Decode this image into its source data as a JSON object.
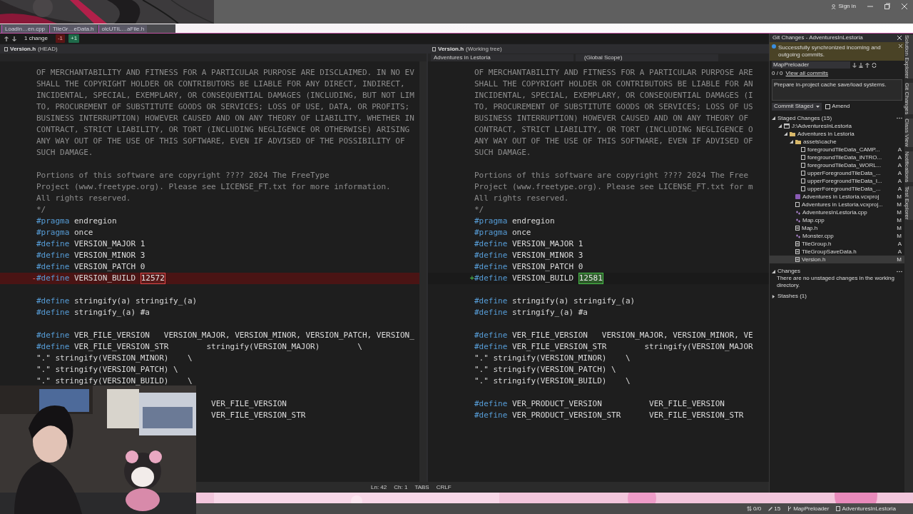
{
  "title_bar": {
    "sign_in": "Sign in"
  },
  "file_tabs": [
    "Loadin…en.cpp",
    "TileGr…eData.h",
    "olcUTIL…aFile.h"
  ],
  "diff_toolbar": {
    "change_count": "1 change",
    "removed": "-1",
    "added": "+1"
  },
  "left_pane": {
    "title": "Version.h",
    "subtitle": "(HEAD)",
    "lines": [
      {
        "kind": "comment",
        "text": "OF MERCHANTABILITY AND FITNESS FOR A PARTICULAR PURPOSE ARE DISCLAIMED. IN NO EV"
      },
      {
        "kind": "comment",
        "text": "SHALL THE COPYRIGHT HOLDER OR CONTRIBUTORS BE LIABLE FOR ANY DIRECT, INDIRECT,"
      },
      {
        "kind": "comment",
        "text": "INCIDENTAL, SPECIAL, EXEMPLARY, OR CONSEQUENTIAL DAMAGES (INCLUDING, BUT NOT LIM"
      },
      {
        "kind": "comment",
        "text": "TO, PROCUREMENT OF SUBSTITUTE GOODS OR SERVICES; LOSS OF USE, DATA, OR PROFITS;"
      },
      {
        "kind": "comment",
        "text": "BUSINESS INTERRUPTION) HOWEVER CAUSED AND ON ANY THEORY OF LIABILITY, WHETHER IN"
      },
      {
        "kind": "comment",
        "text": "CONTRACT, STRICT LIABILITY, OR TORT (INCLUDING NEGLIGENCE OR OTHERWISE) ARISING"
      },
      {
        "kind": "comment",
        "text": "ANY WAY OUT OF THE USE OF THIS SOFTWARE, EVEN IF ADVISED OF THE POSSIBILITY OF"
      },
      {
        "kind": "comment",
        "text": "SUCH DAMAGE."
      },
      {
        "kind": "blank"
      },
      {
        "kind": "comment",
        "text": "Portions of this software are copyright ???? 2024 The FreeType"
      },
      {
        "kind": "comment",
        "text": "Project (www.freetype.org). Please see LICENSE_FT.txt for more information."
      },
      {
        "kind": "comment",
        "text": "All rights reserved."
      },
      {
        "kind": "comment",
        "text": "*/"
      },
      {
        "kind": "code",
        "keyword": "#pragma",
        "text": "endregion"
      },
      {
        "kind": "code",
        "keyword": "#pragma",
        "text": "once"
      },
      {
        "kind": "code",
        "keyword": "#define",
        "text": "VERSION_MAJOR 1"
      },
      {
        "kind": "code",
        "keyword": "#define",
        "text": "VERSION_MINOR 3"
      },
      {
        "kind": "code",
        "keyword": "#define",
        "text": "VERSION_PATCH 0"
      },
      {
        "kind": "removed",
        "prefix": "-",
        "keyword": "#define",
        "text": "VERSION_BUILD",
        "changed": "12572"
      },
      {
        "kind": "blank"
      },
      {
        "kind": "code",
        "keyword": "#define",
        "text": "stringify(a) stringify_(a)"
      },
      {
        "kind": "code",
        "keyword": "#define",
        "text": "stringify_(a) #a"
      },
      {
        "kind": "blank"
      },
      {
        "kind": "code",
        "keyword": "#define",
        "text": "VER_FILE_VERSION   VERSION_MAJOR, VERSION_MINOR, VERSION_PATCH, VERSION_"
      },
      {
        "kind": "code",
        "keyword": "#define",
        "text": "VER_FILE_VERSION_STR        stringify(VERSION_MAJOR)        \\"
      },
      {
        "kind": "code",
        "text": "\".\" stringify(VERSION_MINOR)    \\"
      },
      {
        "kind": "code",
        "text": "\".\" stringify(VERSION_PATCH) \\"
      },
      {
        "kind": "code",
        "text": "\".\" stringify(VERSION_BUILD)    \\"
      },
      {
        "kind": "blank"
      },
      {
        "kind": "code",
        "text": "                                     VER_FILE_VERSION"
      },
      {
        "kind": "code",
        "text": "                                     VER_FILE_VERSION_STR"
      }
    ]
  },
  "right_pane": {
    "title": "Version.h",
    "subtitle": "(Working tree)",
    "project": "Adventures in Lestoria",
    "scope": "(Global Scope)",
    "lines": [
      {
        "kind": "comment",
        "text": "OF MERCHANTABILITY AND FITNESS FOR A PARTICULAR PURPOSE ARE"
      },
      {
        "kind": "comment",
        "text": "SHALL THE COPYRIGHT HOLDER OR CONTRIBUTORS BE LIABLE FOR AN"
      },
      {
        "kind": "comment",
        "text": "INCIDENTAL, SPECIAL, EXEMPLARY, OR CONSEQUENTIAL DAMAGES (I"
      },
      {
        "kind": "comment",
        "text": "TO, PROCUREMENT OF SUBSTITUTE GOODS OR SERVICES; LOSS OF US"
      },
      {
        "kind": "comment",
        "text": "BUSINESS INTERRUPTION) HOWEVER CAUSED AND ON ANY THEORY OF"
      },
      {
        "kind": "comment",
        "text": "CONTRACT, STRICT LIABILITY, OR TORT (INCLUDING NEGLIGENCE O"
      },
      {
        "kind": "comment",
        "text": "ANY WAY OUT OF THE USE OF THIS SOFTWARE, EVEN IF ADVISED OF"
      },
      {
        "kind": "comment",
        "text": "SUCH DAMAGE."
      },
      {
        "kind": "blank"
      },
      {
        "kind": "comment",
        "text": "Portions of this software are copyright ???? 2024 The Free"
      },
      {
        "kind": "comment",
        "text": "Project (www.freetype.org). Please see LICENSE_FT.txt for m"
      },
      {
        "kind": "comment",
        "text": "All rights reserved."
      },
      {
        "kind": "comment",
        "text": "*/"
      },
      {
        "kind": "code",
        "keyword": "#pragma",
        "text": "endregion"
      },
      {
        "kind": "code",
        "keyword": "#pragma",
        "text": "once"
      },
      {
        "kind": "code",
        "keyword": "#define",
        "text": "VERSION_MAJOR 1"
      },
      {
        "kind": "code",
        "keyword": "#define",
        "text": "VERSION_MINOR 3"
      },
      {
        "kind": "code",
        "keyword": "#define",
        "text": "VERSION_PATCH 0"
      },
      {
        "kind": "added",
        "prefix": "+",
        "keyword": "#define",
        "text": "VERSION_BUILD",
        "changed": "12581"
      },
      {
        "kind": "blank"
      },
      {
        "kind": "code",
        "keyword": "#define",
        "text": "stringify(a) stringify_(a)"
      },
      {
        "kind": "code",
        "keyword": "#define",
        "text": "stringify_(a) #a"
      },
      {
        "kind": "blank"
      },
      {
        "kind": "code",
        "keyword": "#define",
        "text": "VER_FILE_VERSION   VERSION_MAJOR, VERSION_MINOR, VE"
      },
      {
        "kind": "code",
        "keyword": "#define",
        "text": "VER_FILE_VERSION_STR        stringify(VERSION_MAJOR"
      },
      {
        "kind": "code",
        "text": "\".\" stringify(VERSION_MINOR)    \\"
      },
      {
        "kind": "code",
        "text": "\".\" stringify(VERSION_PATCH) \\"
      },
      {
        "kind": "code",
        "text": "\".\" stringify(VERSION_BUILD)    \\"
      },
      {
        "kind": "blank"
      },
      {
        "kind": "code",
        "keyword": "#define",
        "text": "VER_PRODUCT_VERSION          VER_FILE_VERSION"
      },
      {
        "kind": "code",
        "keyword": "#define",
        "text": "VER_PRODUCT_VERSION_STR      VER_FILE_VERSION_STR"
      }
    ]
  },
  "editor_status": {
    "line": "Ln: 42",
    "column": "Ch: 1",
    "indent": "TABS",
    "line_ending": "CRLF"
  },
  "git_panel": {
    "title": "Git Changes - AdventuresInLestoria",
    "info": "Successfully synchronized incoming and outgoing commits.",
    "branch": "MapPreloader",
    "sync": "0 / 0",
    "view_commits": "View all commits",
    "message": "Prepare in-project cache save/load systems.",
    "commit_button": "Commit Staged",
    "amend": {
      "label": "Amend",
      "checked": false
    },
    "staged_header": "Staged Changes (15)",
    "staged": [
      {
        "kind": "repo",
        "label": "J:\\AdventuresInLestoria",
        "expanded": true,
        "children": [
          {
            "kind": "folder",
            "label": "Adventures in Lestoria",
            "expanded": true,
            "children": [
              {
                "kind": "folder",
                "label": "assets\\cache",
                "expanded": true,
                "children": [
                  {
                    "kind": "file",
                    "label": "foregroundTileData_CAMP...",
                    "status": "A",
                    "selected": false
                  },
                  {
                    "kind": "file",
                    "label": "foregroundTileData_INTRO...",
                    "status": "A",
                    "selected": false
                  },
                  {
                    "kind": "file",
                    "label": "foregroundTileData_WORL...",
                    "status": "A",
                    "selected": false
                  },
                  {
                    "kind": "file",
                    "label": "upperForegroundTileData_...",
                    "status": "A",
                    "selected": false
                  },
                  {
                    "kind": "file",
                    "label": "upperForegroundTileData_I...",
                    "status": "A",
                    "selected": false
                  },
                  {
                    "kind": "file",
                    "label": "upperForegroundTileData_...",
                    "status": "A",
                    "selected": false
                  }
                ]
              },
              {
                "kind": "project",
                "label": "Adventures in Lestoria.vcxproj",
                "status": "M",
                "selected": false
              },
              {
                "kind": "file",
                "label": "Adventures in Lestoria.vcxproj...",
                "status": "M",
                "selected": false
              },
              {
                "kind": "cpp",
                "label": "AdventuresInLestoria.cpp",
                "status": "M",
                "selected": false
              },
              {
                "kind": "cpp",
                "label": "Map.cpp",
                "status": "M",
                "selected": false
              },
              {
                "kind": "header",
                "label": "Map.h",
                "status": "M",
                "selected": false
              },
              {
                "kind": "cpp",
                "label": "Monster.cpp",
                "status": "M",
                "selected": false
              },
              {
                "kind": "header",
                "label": "TileGroup.h",
                "status": "A",
                "selected": false
              },
              {
                "kind": "header",
                "label": "TileGroupSaveData.h",
                "status": "A",
                "selected": false
              },
              {
                "kind": "header",
                "label": "Version.h",
                "status": "M",
                "selected": true
              }
            ]
          }
        ]
      }
    ],
    "changes_header": "Changes",
    "changes_note": "There are no unstaged changes in the working directory.",
    "stashes": "Stashes (1)"
  },
  "side_tabs": [
    "Solution Explorer",
    "Git Changes",
    "Class View",
    "Notifications",
    "Test Explorer"
  ],
  "status_bar": {
    "sync": "0/0",
    "edits": "15",
    "branch": "MapPreloader",
    "repo": "AdventuresInLestoria"
  },
  "webcam": {
    "kind": "picture"
  }
}
